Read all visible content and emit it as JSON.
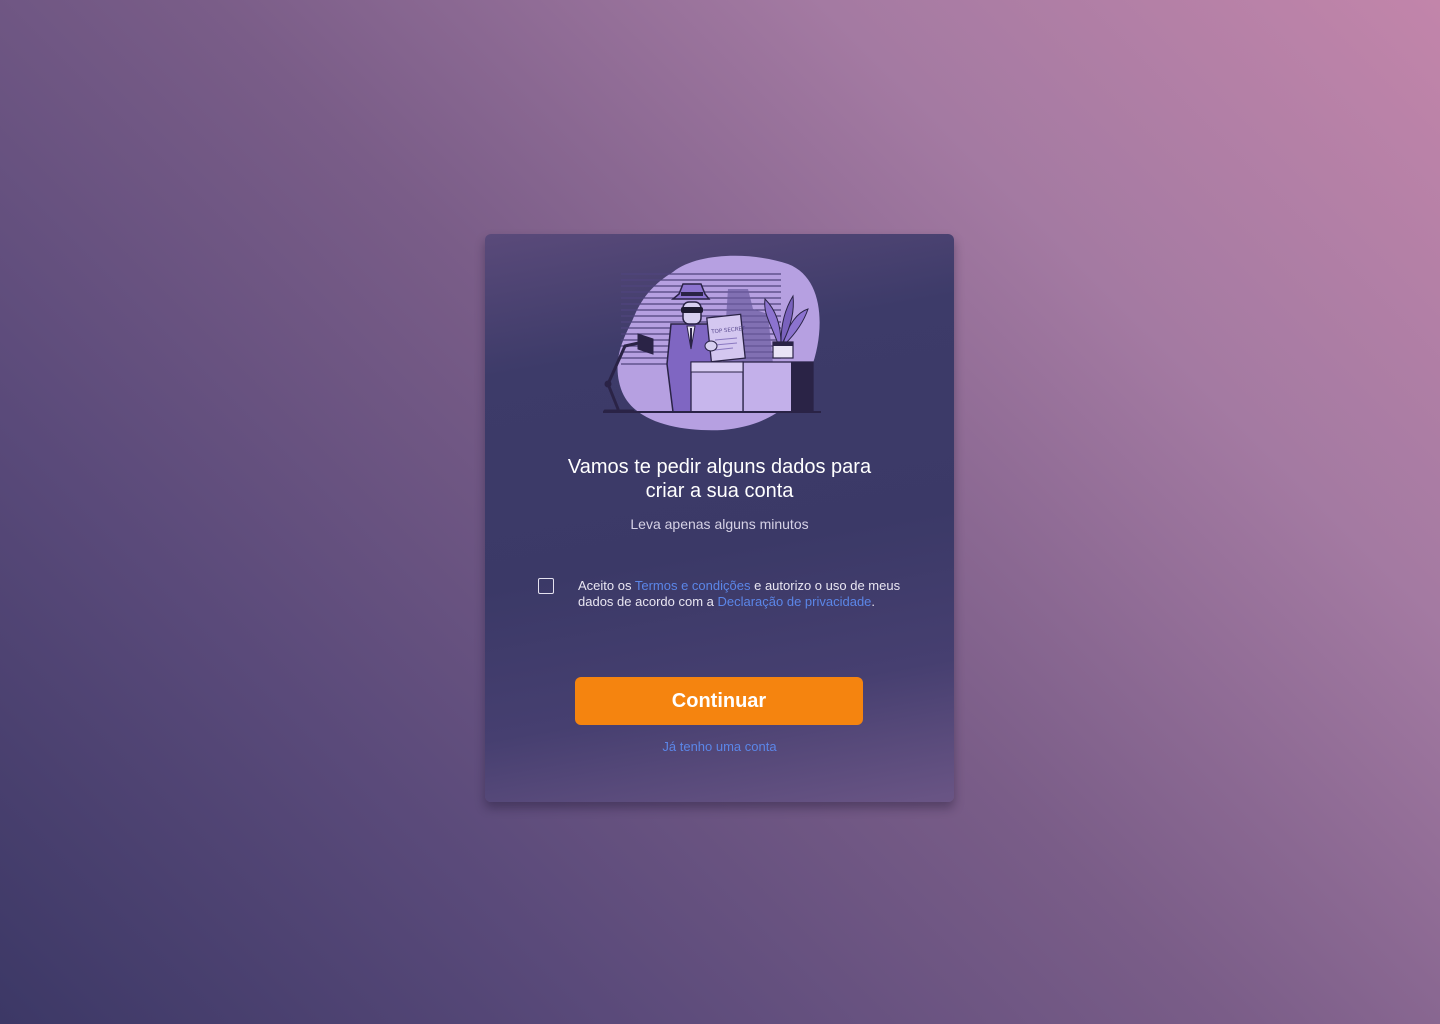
{
  "onboarding": {
    "title": "Vamos te pedir alguns dados para\ncriar a sua conta",
    "subtitle": "Leva apenas alguns minutos",
    "terms": {
      "prefix": "Aceito os ",
      "terms_link": "Termos e condições",
      "middle": " e autorizo o uso de meus dados de acordo com a ",
      "privacy_link": "Declaração de privacidade",
      "suffix": "."
    },
    "continue_label": "Continuar",
    "login_link": "Já tenho uma conta",
    "illustration": {
      "icon": "secret-agent-illustration",
      "sign_text": "TOP SECRET"
    }
  },
  "colors": {
    "accent": "#f5840f",
    "link": "#5b86e8",
    "card": "#3c3a68",
    "illustration_bg": "#b7a0e2"
  }
}
